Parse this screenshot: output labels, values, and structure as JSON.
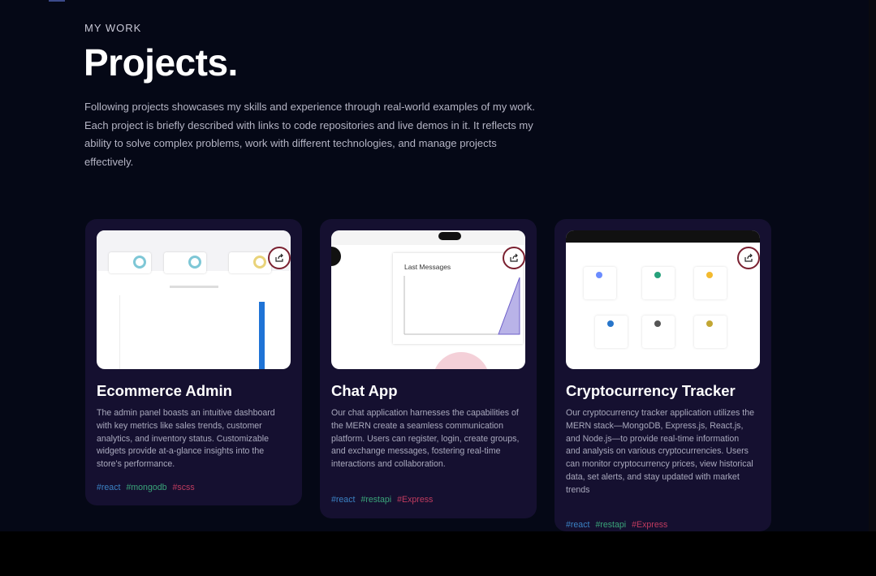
{
  "section": {
    "subtitle": "MY WORK",
    "title": "Projects.",
    "intro": "Following projects showcases my skills and experience through real-world examples of my work. Each project is briefly described with links to code repositories and live demos in it. It reflects my ability to solve complex problems, work with different technologies, and manage projects effectively."
  },
  "projects": [
    {
      "title": "Ecommerce Admin",
      "description": "The admin panel boasts an intuitive dashboard with key metrics like sales trends, customer analytics, and inventory status. Customizable widgets provide at-a-glance insights into the store's performance.",
      "tags": [
        "#react",
        "#mongodb",
        "#scss"
      ],
      "share_icon": "share-icon"
    },
    {
      "title": "Chat App",
      "description": "Our chat application harnesses the capabilities of the MERN create a seamless communication platform. Users can register, login, create groups, and exchange messages, fostering real-time interactions and collaboration.",
      "tags": [
        "#react",
        "#restapi",
        "#Express"
      ],
      "share_icon": "share-icon",
      "thumb_label": "Last Messages"
    },
    {
      "title": "Cryptocurrency Tracker",
      "description": "Our cryptocurrency tracker application utilizes the MERN stack—MongoDB, Express.js, React.js, and Node.js—to provide real-time information and analysis on various cryptocurrencies. Users can monitor cryptocurrency prices, view historical data, set alerts, and stay updated with market trends",
      "tags": [
        "#react",
        "#restapi",
        "#Express"
      ],
      "share_icon": "share-icon"
    }
  ],
  "colors": {
    "background": "#050816",
    "card": "#151030",
    "tag_blue": "#3b82c4",
    "tag_green": "#3aa57a",
    "tag_pink": "#c03b5f"
  }
}
